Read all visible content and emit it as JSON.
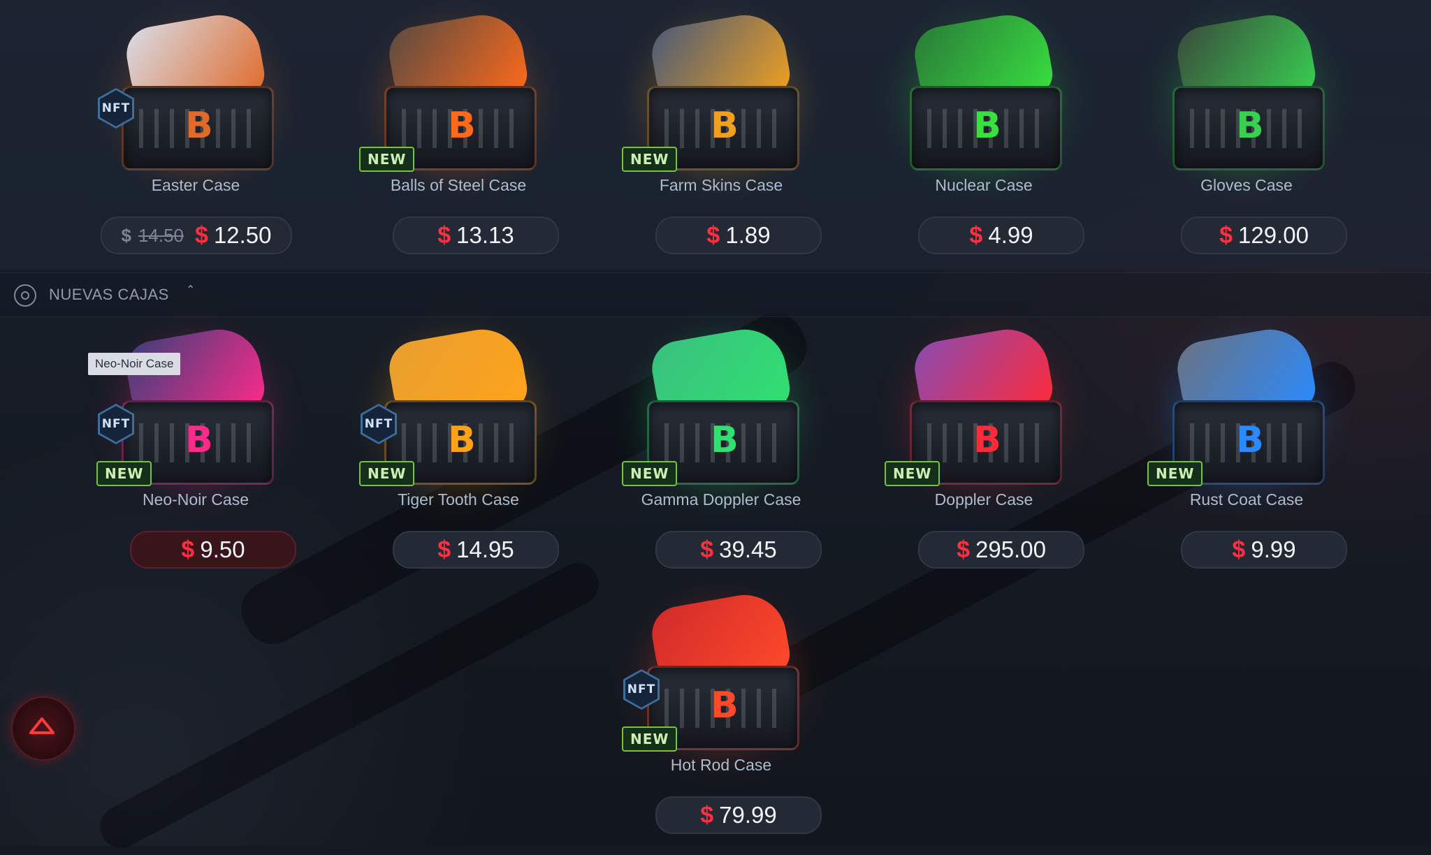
{
  "section": {
    "title": "NUEVAS CAJAS",
    "collapse_icon": "chevron-up-icon"
  },
  "tooltip": "Neo-Noir Case",
  "top_row": [
    {
      "name": "Easter Case",
      "nft": true,
      "new": false,
      "old_currency": "$",
      "old_price": "14.50",
      "currency": "$",
      "price": "12.50",
      "accent": "#e06a2a",
      "item": "#d8dde8"
    },
    {
      "name": "Balls of Steel Case",
      "nft": false,
      "new": true,
      "currency": "$",
      "price": "13.13",
      "accent": "#ff6a1a",
      "item": "#5a4a42"
    },
    {
      "name": "Farm Skins Case",
      "nft": false,
      "new": true,
      "currency": "$",
      "price": "1.89",
      "accent": "#f0a020",
      "item": "#4a5a78"
    },
    {
      "name": "Nuclear Case",
      "nft": false,
      "new": false,
      "currency": "$",
      "price": "4.99",
      "accent": "#38e040",
      "item": "#2a7a38"
    },
    {
      "name": "Gloves Case",
      "nft": false,
      "new": false,
      "currency": "$",
      "price": "129.00",
      "accent": "#38d050",
      "item": "#3a4a3c"
    }
  ],
  "new_row": [
    {
      "name": "Neo-Noir Case",
      "nft": true,
      "new": true,
      "currency": "$",
      "price": "9.50",
      "selected": true,
      "accent": "#ff2a8a",
      "item": "#3a3f7a"
    },
    {
      "name": "Tiger Tooth Case",
      "nft": true,
      "new": true,
      "currency": "$",
      "price": "14.95",
      "accent": "#ffa21a",
      "item": "#e8a030"
    },
    {
      "name": "Gamma Doppler Case",
      "nft": false,
      "new": true,
      "currency": "$",
      "price": "39.45",
      "accent": "#30e070",
      "item": "#3ac080"
    },
    {
      "name": "Doppler Case",
      "nft": false,
      "new": true,
      "currency": "$",
      "price": "295.00",
      "accent": "#ff2a3a",
      "item": "#8a4ab0"
    },
    {
      "name": "Rust Coat Case",
      "nft": false,
      "new": true,
      "currency": "$",
      "price": "9.99",
      "accent": "#2a8aff",
      "item": "#6a7282"
    }
  ],
  "last_row": [
    {
      "name": "Hot Rod Case",
      "nft": true,
      "new": true,
      "currency": "$",
      "price": "79.99",
      "accent": "#ff4a2a",
      "item": "#d02a2a"
    }
  ],
  "badges": {
    "nft": "NFT",
    "new": "NEW"
  },
  "logo_letter": "B",
  "scroll_top_icon": "arrow-up-icon"
}
